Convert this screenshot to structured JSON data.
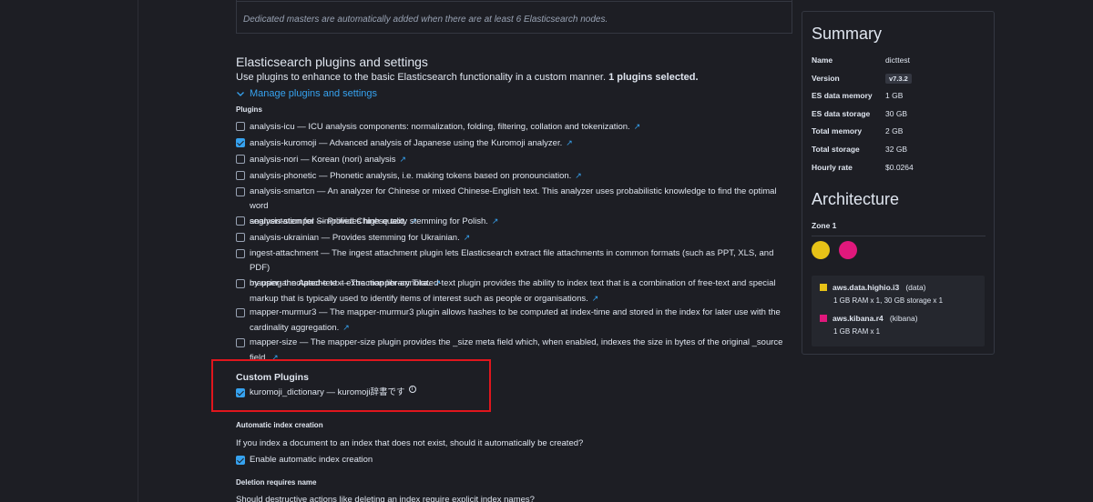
{
  "note": "Dedicated masters are automatically added when there are at least 6 Elasticsearch nodes.",
  "plugins_section": {
    "title": "Elasticsearch plugins and settings",
    "desc_prefix": "Use plugins to enhance to the basic Elasticsearch functionality in a custom manner.",
    "desc_bold": "1 plugins selected.",
    "manage_link": "Manage plugins and settings",
    "plugins_label": "Plugins"
  },
  "plugins": [
    {
      "line1": "analysis-icu — ICU analysis components: normalization, folding, filtering, collation and tokenization.",
      "line2": "",
      "checked": false
    },
    {
      "line1": "analysis-kuromoji — Advanced analysis of Japanese using the Kuromoji analyzer.",
      "line2": "",
      "checked": true
    },
    {
      "line1": "analysis-nori — Korean (nori) analysis",
      "line2": "",
      "checked": false
    },
    {
      "line1": "analysis-phonetic — Phonetic analysis, i.e. making tokens based on pronounciation.",
      "line2": "",
      "checked": false
    },
    {
      "line1": "analysis-smartcn — An analyzer for Chinese or mixed Chinese-English text. This analyzer uses probabilistic knowledge to find the optimal word",
      "line2": "segmentation for Simplified Chinese text.",
      "checked": false
    },
    {
      "line1": "analysis-stempel — Provides high quality stemming for Polish.",
      "line2": "",
      "checked": false
    },
    {
      "line1": "analysis-ukrainian — Provides stemming for Ukrainian.",
      "line2": "",
      "checked": false
    },
    {
      "line1": "ingest-attachment — The ingest attachment plugin lets Elasticsearch extract file attachments in common formats (such as PPT, XLS, and PDF)",
      "line2": "by using the Apache text extraction library Tika.",
      "checked": false
    },
    {
      "line1": "mapper-annotated-text — The mapper-annotated-text plugin provides the ability to index text that is a combination of free-text and special",
      "line2": "markup that is typically used to identify items of interest such as people or organisations.",
      "checked": false
    },
    {
      "line1": "mapper-murmur3 — The mapper-murmur3 plugin allows hashes to be computed at index-time and stored in the index for later use with the",
      "line2": "cardinality aggregation.",
      "checked": false
    },
    {
      "line1": "mapper-size — The mapper-size plugin provides the _size meta field which, when enabled, indexes the size in bytes of the original _source",
      "line2": "field.",
      "checked": false
    }
  ],
  "custom_plugins": {
    "title": "Custom Plugins",
    "item": "kuromoji_dictionary — kuromoji辞書です",
    "checked": true
  },
  "auto_index": {
    "label": "Automatic index creation",
    "question": "If you index a document to an index that does not exist, should it automatically be created?",
    "checkbox": "Enable automatic index creation",
    "checked": true
  },
  "deletion": {
    "label": "Deletion requires name",
    "question": "Should destructive actions like deleting an index require explicit index names?"
  },
  "summary": {
    "title": "Summary",
    "rows": [
      {
        "key": "Name",
        "value": "dicttest"
      },
      {
        "key": "Version",
        "value": "v7.3.2"
      },
      {
        "key": "ES data memory",
        "value": "1 GB"
      },
      {
        "key": "ES data storage",
        "value": "30 GB"
      },
      {
        "key": "Total memory",
        "value": "2 GB"
      },
      {
        "key": "Total storage",
        "value": "32 GB"
      },
      {
        "key": "Hourly rate",
        "value": "$0.0264"
      }
    ]
  },
  "architecture": {
    "title": "Architecture",
    "zone": "Zone 1",
    "dot_colors": [
      "#e7c217",
      "#e0187c"
    ],
    "legend": [
      {
        "name": "aws.data.highio.i3",
        "role": "(data)",
        "detail": "1 GB RAM x 1, 30 GB storage x 1",
        "color": "#e7c217"
      },
      {
        "name": "aws.kibana.r4",
        "role": "(kibana)",
        "detail": "1 GB RAM x 1",
        "color": "#e0187c"
      }
    ]
  }
}
